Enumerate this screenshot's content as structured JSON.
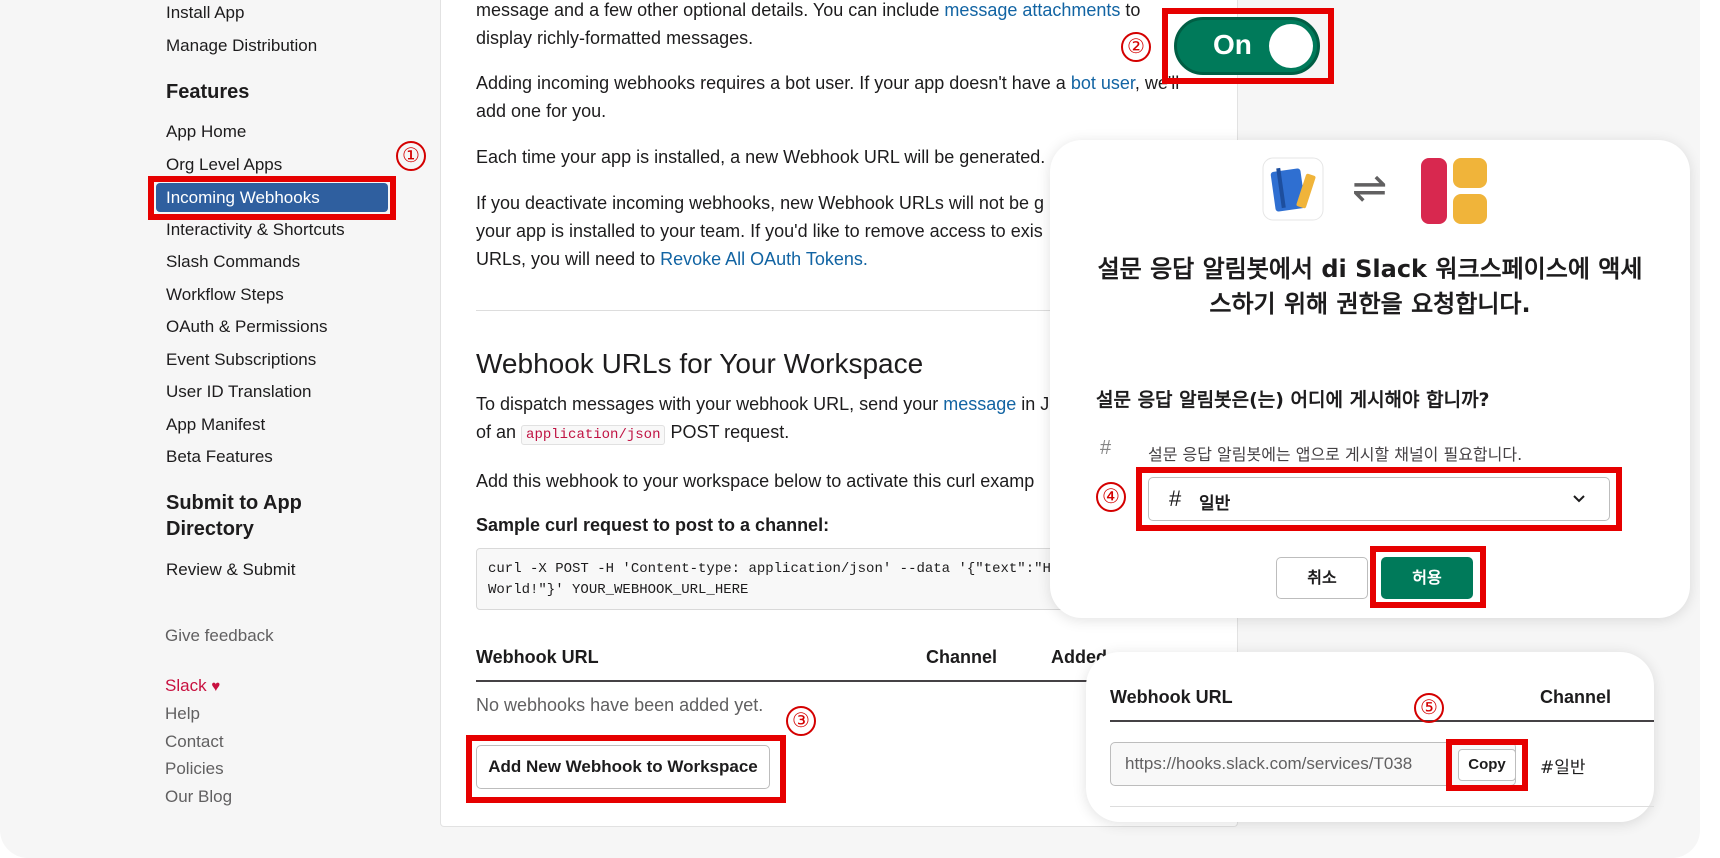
{
  "sidebar": {
    "top_items": [
      "Install App",
      "Manage Distribution"
    ],
    "features_heading": "Features",
    "features_items": [
      "App Home",
      "Org Level Apps",
      "Incoming Webhooks",
      "Interactivity & Shortcuts",
      "Slash Commands",
      "Workflow Steps",
      "OAuth & Permissions",
      "Event Subscriptions",
      "User ID Translation",
      "App Manifest",
      "Beta Features"
    ],
    "active_item": "Incoming Webhooks",
    "submit_heading_line1": "Submit to App",
    "submit_heading_line2": "Directory",
    "submit_items": [
      "Review & Submit"
    ],
    "give_feedback": "Give feedback",
    "footer": {
      "slack": "Slack",
      "heart": "♥",
      "help": "Help",
      "contact": "Contact",
      "policies": "Policies",
      "blog": "Our Blog"
    }
  },
  "content": {
    "intro_p1": {
      "line1_pre": "message and a few other optional details. You can include ",
      "line1_link": "message attachments",
      "line1_post": " to",
      "line2": "display richly-formatted messages."
    },
    "intro_p2": {
      "pre": "Adding incoming webhooks requires a bot user. If your app doesn't have a ",
      "link": "bot user",
      "post": ", we'll",
      "line2": "add one for you."
    },
    "intro_p3": "Each time your app is installed, a new Webhook URL will be generated.",
    "intro_p4": {
      "line1": "If you deactivate incoming webhooks, new Webhook URLs will not be g",
      "line2": "your app is installed to your team. If you'd like to remove access to exis",
      "line3_pre": "URLs, you will need to ",
      "line3_link": "Revoke All OAuth Tokens."
    },
    "section_title": "Webhook URLs for Your Workspace",
    "dispatch": {
      "pre": "To dispatch messages with your webhook URL, send your ",
      "link": "message",
      "post": " in JS",
      "line2_pre": "of an ",
      "code": "application/json",
      "line2_post": " POST request."
    },
    "add_text": "Add this webhook to your workspace below to activate this curl examp",
    "sample_label": "Sample curl request to post to a channel:",
    "curl_line1": "curl -X POST -H 'Content-type: application/json' --data '{\"text\":\"He",
    "curl_line2": "World!\"}' YOUR_WEBHOOK_URL_HERE",
    "table_headers": {
      "url": "Webhook URL",
      "channel": "Channel",
      "added": "Added"
    },
    "empty_text": "No webhooks have been added yet.",
    "add_button": "Add New Webhook to Workspace"
  },
  "toggle": {
    "label": "On",
    "state": "on",
    "color": "#007a5a"
  },
  "annotations": [
    "①",
    "②",
    "③",
    "④",
    "⑤"
  ],
  "dialog": {
    "arrows": "⇌",
    "title_line1": "설문 응답 알림봇에서 di Slack 워크스페이스에 액세",
    "title_line2": "스하기 위해 권한을 요청합니다.",
    "question": "설문 응답 알림봇은(는) 어디에 게시해야 합니까?",
    "hint_hash": "#",
    "hint": "설문 응답 알림봇에는 앱으로 게시할 채널이 필요합니다.",
    "select_hash": "#",
    "select_value": "일반",
    "cancel": "취소",
    "allow": "허용"
  },
  "webhook_card": {
    "col_url": "Webhook URL",
    "col_channel": "Channel",
    "url": "https://hooks.slack.com/services/T038",
    "copy": "Copy",
    "channel": "#일반"
  },
  "colors": {
    "accent_green": "#007a5a",
    "link_blue": "#1264a3",
    "highlight_red": "#e60000",
    "active_blue": "#2f5f9f"
  }
}
